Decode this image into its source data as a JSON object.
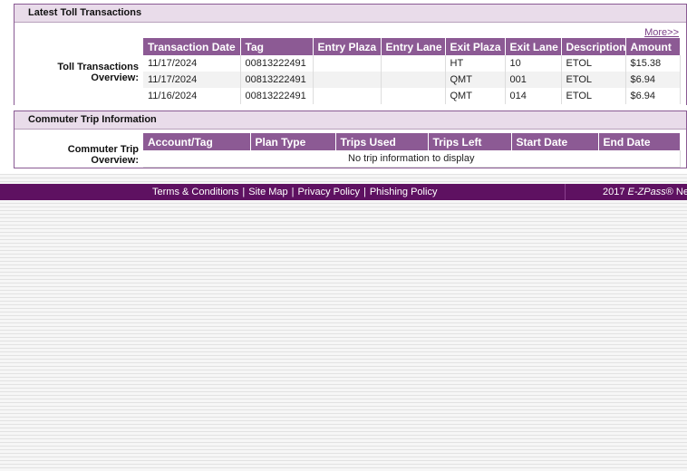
{
  "toll_section": {
    "header": "Latest Toll Transactions",
    "more_link": "More>>",
    "label": "Toll Transactions Overview:",
    "columns": [
      "Transaction Date",
      "Tag",
      "Entry Plaza",
      "Entry Lane",
      "Exit Plaza",
      "Exit Lane",
      "Description",
      "Amount"
    ],
    "rows": [
      [
        "11/17/2024",
        "00813222491",
        "",
        "",
        "HT",
        "10",
        "ETOL",
        "$15.38"
      ],
      [
        "11/17/2024",
        "00813222491",
        "",
        "",
        "QMT",
        "001",
        "ETOL",
        "$6.94"
      ],
      [
        "11/16/2024",
        "00813222491",
        "",
        "",
        "QMT",
        "014",
        "ETOL",
        "$6.94"
      ]
    ]
  },
  "commute_section": {
    "header": "Commuter Trip Information",
    "label": "Commuter Trip Overview:",
    "columns": [
      "Account/Tag",
      "Plan Type",
      "Trips Used",
      "Trips Left",
      "Start Date",
      "End Date"
    ],
    "empty_message": "No trip information to display"
  },
  "footer": {
    "links": [
      "Terms & Conditions",
      "Site Map",
      "Privacy Policy",
      "Phishing Policy"
    ],
    "separator": "|",
    "copyright_prefix": "2017 ",
    "copyright_brand": "E-ZPass",
    "copyright_suffix": "® New Y"
  },
  "colors": {
    "header_purple": "#8c5a94",
    "section_header_bg": "#e9dcea",
    "footer_bg": "#5e1161",
    "link_color": "#7a3f86"
  }
}
